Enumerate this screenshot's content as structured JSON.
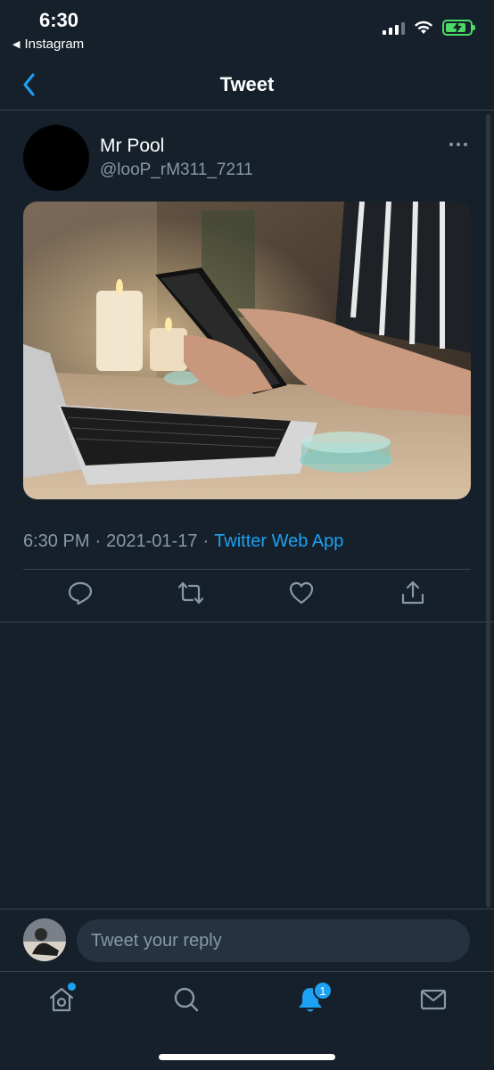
{
  "status_bar": {
    "time": "6:30",
    "back_app": "Instagram"
  },
  "nav": {
    "title": "Tweet"
  },
  "tweet": {
    "display_name": "Mr Pool",
    "handle": "@looP_rM311_7211",
    "time": "6:30 PM",
    "date": "2021-01-17",
    "separator": "·",
    "source": "Twitter Web App",
    "media_description_icon": "photo-of-hands-using-phone-at-laptop"
  },
  "actions": [
    "reply-icon",
    "retweet-icon",
    "like-icon",
    "share-icon"
  ],
  "reply": {
    "placeholder": "Tweet your reply"
  },
  "tab_bar": {
    "items": [
      "home-icon",
      "search-icon",
      "notifications-icon",
      "messages-icon"
    ],
    "notifications_badge": "1"
  },
  "colors": {
    "background": "#15202b",
    "accent": "#1da1f2",
    "secondary_text": "#8899a6",
    "divider": "#38444d"
  }
}
